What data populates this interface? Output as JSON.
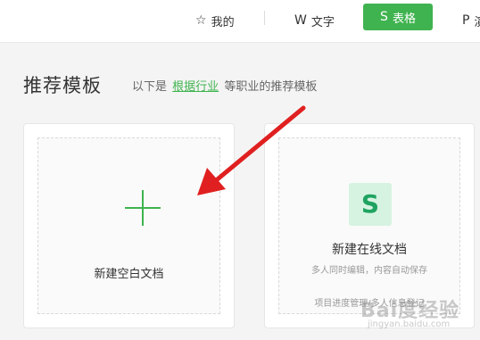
{
  "nav": {
    "mine": {
      "icon": "star-icon",
      "glyph": "☆",
      "label": "我的"
    },
    "text": {
      "icon": "doc-w-icon",
      "glyph": "W",
      "label": "文字"
    },
    "sheet": {
      "icon": "sheet-s-icon",
      "glyph": "S",
      "label": "表格",
      "active": true
    },
    "ppt": {
      "icon": "ppt-p-icon",
      "glyph": "P",
      "label": "演"
    }
  },
  "section": {
    "title": "推荐模板",
    "sub_prefix": "以下是",
    "sub_link": "根据行业",
    "sub_suffix": "等职业的推荐模板"
  },
  "cards": {
    "blank": {
      "icon": "plus-icon",
      "label": "新建空白文档"
    },
    "online": {
      "icon": "sheet-s-icon",
      "glyph": "S",
      "title": "新建在线文档",
      "desc": "多人同时编辑，内容自动保存",
      "tags": "项目进度管理/多人信息登记"
    }
  },
  "watermark": {
    "main": "Bai度经验",
    "sub": "jingyan.baidu.com"
  },
  "colors": {
    "accent": "#3fb34f",
    "arrow": "#e02020",
    "logo_bg": "#d6f3e1"
  }
}
